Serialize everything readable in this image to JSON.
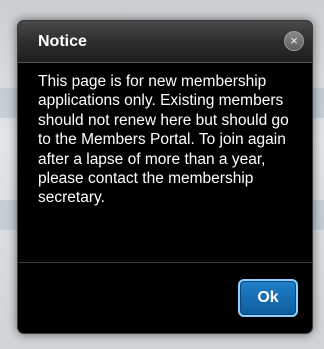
{
  "dialog": {
    "title": "Notice",
    "close_glyph": "×",
    "message": "This page is for new membership applications only. Existing members should not renew here but should go to the Members Portal. To join again after a lapse of more than a year, please contact the membership secretary.",
    "ok_label": "Ok"
  },
  "icons": {
    "close": "close-icon"
  },
  "colors": {
    "dialog_bg": "#000000",
    "header_bg": "#2c2c2c",
    "ok_button": "#1670b5",
    "ok_border": "#8fd0ff"
  }
}
